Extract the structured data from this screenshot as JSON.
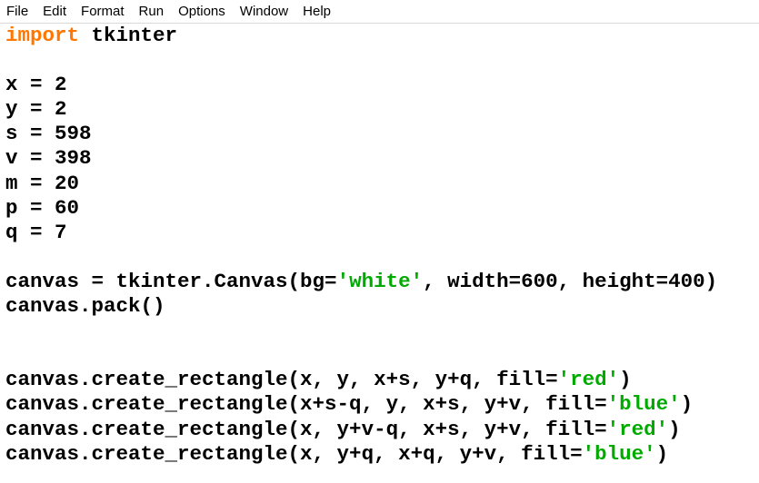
{
  "menu": {
    "items": [
      "File",
      "Edit",
      "Format",
      "Run",
      "Options",
      "Window",
      "Help"
    ]
  },
  "colors": {
    "keyword": "#ff7700",
    "string": "#00aa00",
    "text": "#000000",
    "background": "#ffffff"
  },
  "editor": {
    "lines": [
      [
        {
          "t": "import",
          "c": "kw"
        },
        {
          "t": " tkinter"
        }
      ],
      [],
      [
        {
          "t": "x = 2"
        }
      ],
      [
        {
          "t": "y = 2"
        }
      ],
      [
        {
          "t": "s = 598"
        }
      ],
      [
        {
          "t": "v = 398"
        }
      ],
      [
        {
          "t": "m = 20"
        }
      ],
      [
        {
          "t": "p = 60"
        }
      ],
      [
        {
          "t": "q = 7"
        }
      ],
      [],
      [
        {
          "t": "canvas = tkinter.Canvas(bg="
        },
        {
          "t": "'white'",
          "c": "str"
        },
        {
          "t": ", width=600, height=400)"
        }
      ],
      [
        {
          "t": "canvas.pack()"
        }
      ],
      [],
      [],
      [
        {
          "t": "canvas.create_rectangle(x, y, x+s, y+q, fill="
        },
        {
          "t": "'red'",
          "c": "str"
        },
        {
          "t": ")"
        }
      ],
      [
        {
          "t": "canvas.create_rectangle(x+s-q, y, x+s, y+v, fill="
        },
        {
          "t": "'blue'",
          "c": "str"
        },
        {
          "t": ")"
        }
      ],
      [
        {
          "t": "canvas.create_rectangle(x, y+v-q, x+s, y+v, fill="
        },
        {
          "t": "'red'",
          "c": "str"
        },
        {
          "t": ")"
        }
      ],
      [
        {
          "t": "canvas.create_rectangle(x, y+q, x+q, y+v, fill="
        },
        {
          "t": "'blue'",
          "c": "str"
        },
        {
          "t": ")"
        }
      ]
    ]
  }
}
